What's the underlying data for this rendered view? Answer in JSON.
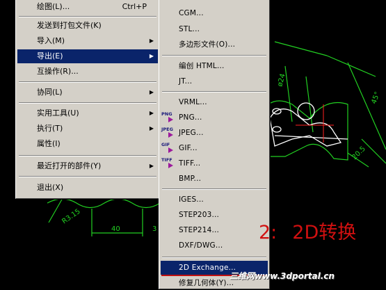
{
  "file_menu": {
    "items": [
      {
        "label": "绘图(L)...",
        "shortcut": "Ctrl+P"
      },
      {
        "label": "发送到打包文件(K)"
      },
      {
        "label": "导入(M)",
        "submenu": true
      },
      {
        "label": "导出(E)",
        "submenu": true,
        "selected": true
      },
      {
        "label": "互操作(R)..."
      },
      {
        "label": "协同(L)",
        "submenu": true
      },
      {
        "label": "实用工具(U)",
        "submenu": true
      },
      {
        "label": "执行(T)",
        "submenu": true
      },
      {
        "label": "属性(I)"
      },
      {
        "label": "最近打开的部件(Y)",
        "submenu": true
      },
      {
        "label": "退出(X)"
      }
    ]
  },
  "export_menu": {
    "items": [
      {
        "label": "CGM..."
      },
      {
        "label": "STL..."
      },
      {
        "label": "多边形文件(O)..."
      },
      {
        "label": "编创 HTML..."
      },
      {
        "label": "JT..."
      },
      {
        "label": "VRML..."
      },
      {
        "label": "PNG...",
        "icon": "PNG"
      },
      {
        "label": "JPEG...",
        "icon": "JPEG"
      },
      {
        "label": "GIF...",
        "icon": "GIF"
      },
      {
        "label": "TIFF...",
        "icon": "TIFF"
      },
      {
        "label": "BMP..."
      },
      {
        "label": "IGES..."
      },
      {
        "label": "STEP203..."
      },
      {
        "label": "STEP214..."
      },
      {
        "label": "DXF/DWG..."
      },
      {
        "label": "2D Exchange...",
        "selected": true
      },
      {
        "label": "修复几何体(Y)..."
      }
    ]
  },
  "cad_dims": {
    "d1": "ø24",
    "d2": "45°",
    "d3": "20.5",
    "d4": "R3.15",
    "d5": "40",
    "d6": "3"
  },
  "annotation": {
    "number": "2:",
    "text": "2D转换"
  },
  "watermark": "三维网www.3dportal.cn",
  "colors": {
    "cad_lines": "#22d022",
    "selection": "#0a246a",
    "annotation": "#d01010"
  }
}
